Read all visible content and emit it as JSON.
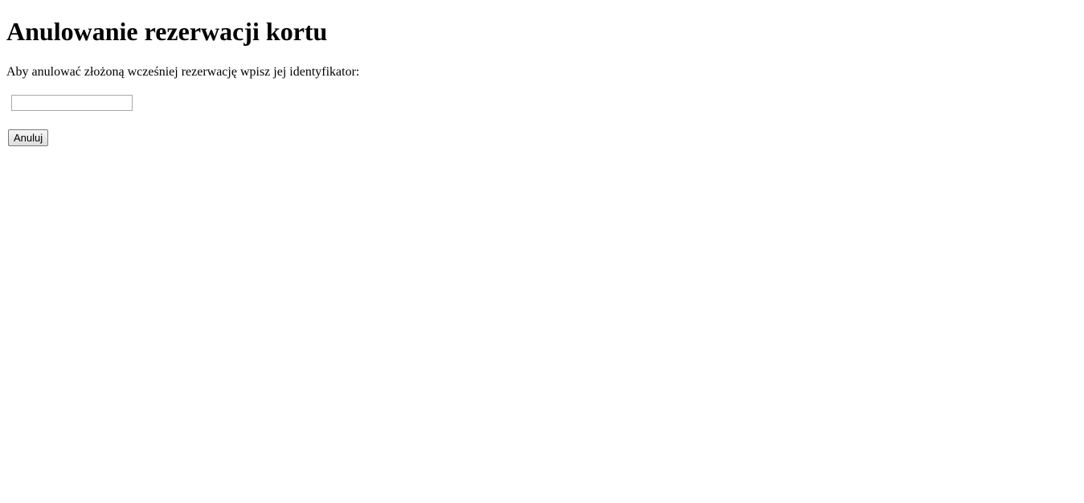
{
  "page": {
    "title": "Anulowanie rezerwacji kortu",
    "intro": "Aby anulować złożoną wcześniej rezerwację wpisz jej identyfikator:"
  },
  "form": {
    "id_input": {
      "value": "",
      "placeholder": ""
    },
    "cancel_label": "Anuluj"
  }
}
